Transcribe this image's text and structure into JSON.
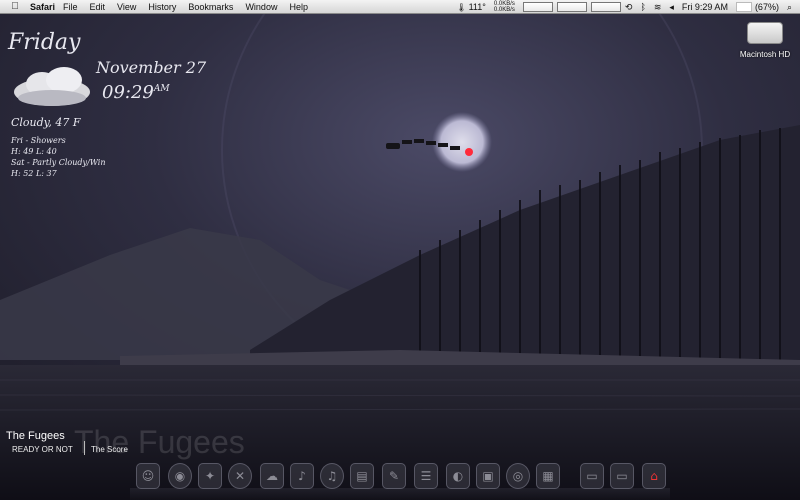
{
  "menubar": {
    "apple": "",
    "app": "Safari",
    "menus": [
      "File",
      "Edit",
      "View",
      "History",
      "Bookmarks",
      "Window",
      "Help"
    ],
    "temperature": "111°",
    "net_up": "0.0KB/s",
    "net_down": "0.0KB/s",
    "clock": "Fri 9:29 AM",
    "battery": "(67%)"
  },
  "weather": {
    "day": "Friday",
    "date": "November 27",
    "time": "09:29",
    "ampm": "AM",
    "current": "Cloudy, 47 F",
    "forecast": [
      "Fri - Showers",
      "H: 49  L: 40",
      "Sat - Partly Cloudy/Win",
      "H: 52  L: 37"
    ]
  },
  "desktop": {
    "hd_label": "Macintosh HD"
  },
  "now_playing": {
    "artist": "The Fugees",
    "album": "READY OR NOT",
    "song": "The Score"
  },
  "colors": {
    "sky_top": "#20202c",
    "moon": "#d8d6ec",
    "water": "#121119"
  }
}
